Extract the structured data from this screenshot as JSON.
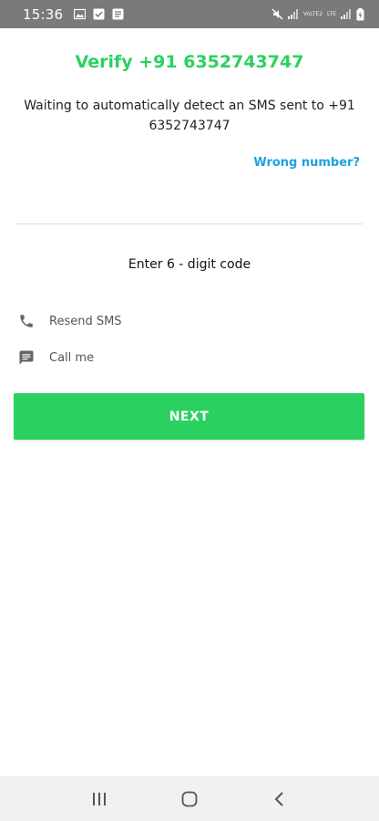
{
  "status_bar": {
    "time": "15:36",
    "network_volte": "VoLTE2",
    "network_lte": "LTE"
  },
  "header": {
    "title": "Verify +91 6352743747"
  },
  "main": {
    "message": "Waiting to automatically detect an SMS sent to +91 6352743747",
    "wrong_number_link": "Wrong number?",
    "code_prompt": "Enter 6 - digit code",
    "options": [
      {
        "label": "Resend SMS",
        "icon": "phone-icon"
      },
      {
        "label": "Call me",
        "icon": "message-icon"
      }
    ],
    "next_label": "NEXT"
  },
  "colors": {
    "accent_green": "#2bd160",
    "link_blue": "#1da1e0",
    "status_bar_gray": "#7a7a7a"
  }
}
